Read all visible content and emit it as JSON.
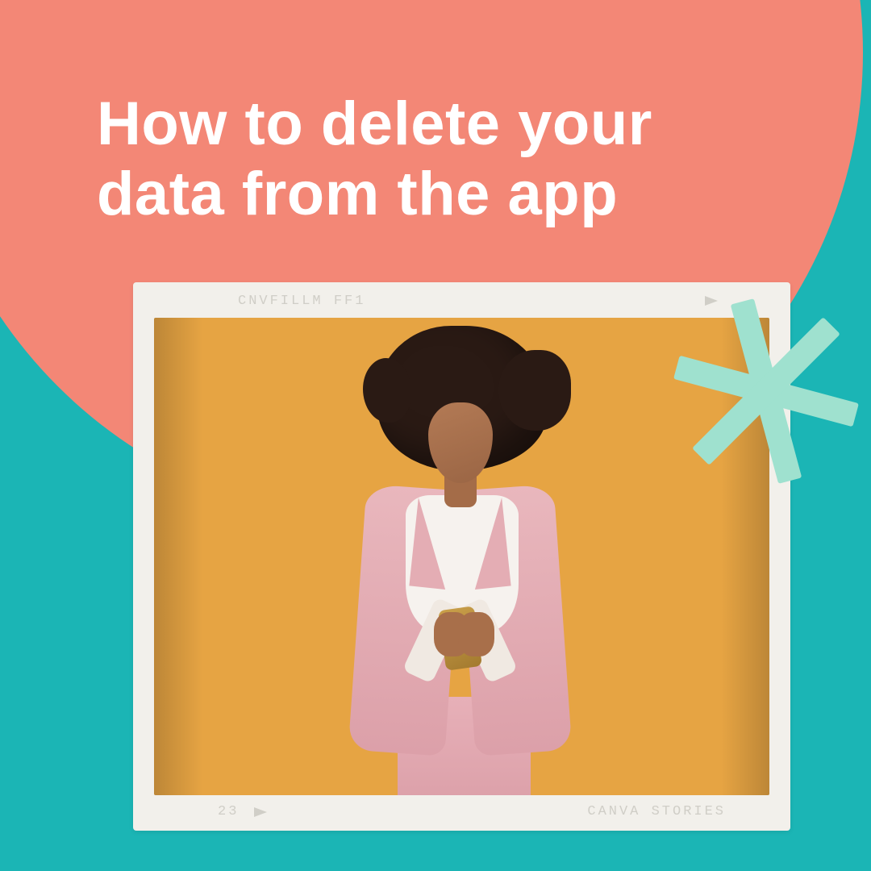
{
  "headline": "How to delete your data from the app",
  "frame": {
    "top_left": "CNVFILLM FF1",
    "bottom_left": "23",
    "bottom_right": "CANVA STORIES"
  }
}
